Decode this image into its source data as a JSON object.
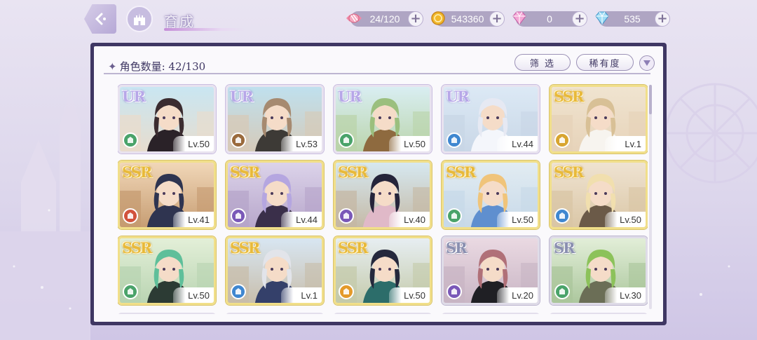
{
  "header": {
    "title": "育成"
  },
  "currencies": [
    {
      "name": "stamina",
      "icon": "candy-icon",
      "value": "24/120"
    },
    {
      "name": "gold",
      "icon": "gold-coin-icon",
      "value": "543360"
    },
    {
      "name": "pink-gem",
      "icon": "pink-diamond-icon",
      "value": "0"
    },
    {
      "name": "blue-gem",
      "icon": "blue-diamond-icon",
      "value": "535"
    }
  ],
  "panel": {
    "count_label": "角色数量: 42/130",
    "filter_label": "筛 选",
    "rarity_label": "稀有度"
  },
  "cards": [
    {
      "rarity": "UR",
      "level": "Lv.50",
      "attr": "green"
    },
    {
      "rarity": "UR",
      "level": "Lv.53",
      "attr": "brown"
    },
    {
      "rarity": "UR",
      "level": "Lv.50",
      "attr": "green"
    },
    {
      "rarity": "UR",
      "level": "Lv.44",
      "attr": "blue"
    },
    {
      "rarity": "SSR",
      "level": "Lv.1",
      "attr": "yellow"
    },
    {
      "rarity": "SSR",
      "level": "Lv.41",
      "attr": "red"
    },
    {
      "rarity": "SSR",
      "level": "Lv.44",
      "attr": "purple"
    },
    {
      "rarity": "SSR",
      "level": "Lv.40",
      "attr": "purple"
    },
    {
      "rarity": "SSR",
      "level": "Lv.50",
      "attr": "green"
    },
    {
      "rarity": "SSR",
      "level": "Lv.50",
      "attr": "blue"
    },
    {
      "rarity": "SSR",
      "level": "Lv.50",
      "attr": "green"
    },
    {
      "rarity": "SSR",
      "level": "Lv.1",
      "attr": "blue"
    },
    {
      "rarity": "SSR",
      "level": "Lv.50",
      "attr": "orange"
    },
    {
      "rarity": "SR",
      "level": "Lv.20",
      "attr": "purple"
    },
    {
      "rarity": "SR",
      "level": "Lv.30",
      "attr": "green"
    }
  ],
  "colors": {
    "panel_frame": "#3f3763",
    "attr_green": "#4aa36a",
    "attr_brown": "#9a6a3c",
    "attr_blue": "#3f87d0",
    "attr_yellow": "#d8a530",
    "attr_red": "#d2523c",
    "attr_purple": "#7a58b8",
    "attr_orange": "#e49a2a"
  }
}
